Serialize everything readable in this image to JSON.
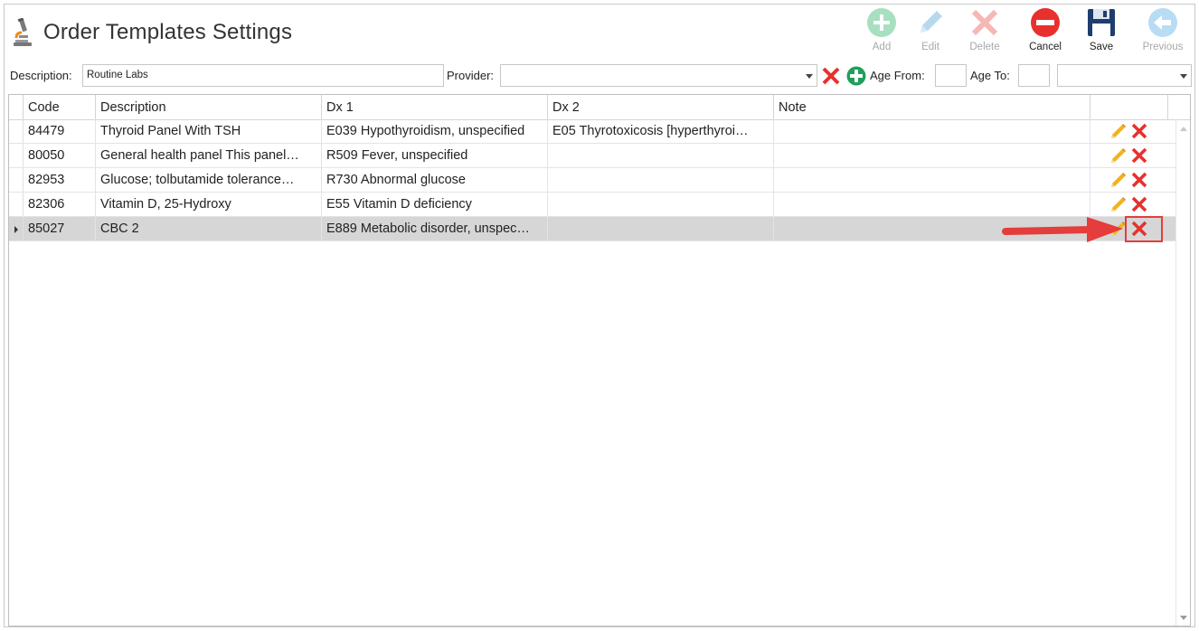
{
  "header": {
    "title": "Order Templates Settings",
    "icon": "microscope-icon"
  },
  "toolbar": {
    "buttons": [
      {
        "label": "Add",
        "icon": "add-icon",
        "enabled": false
      },
      {
        "label": "Edit",
        "icon": "edit-icon",
        "enabled": false
      },
      {
        "label": "Delete",
        "icon": "delete-icon",
        "enabled": false
      },
      {
        "label": "Cancel",
        "icon": "cancel-icon",
        "enabled": true
      },
      {
        "label": "Save",
        "icon": "save-icon",
        "enabled": true
      },
      {
        "label": "Previous",
        "icon": "previous-icon",
        "enabled": false
      }
    ]
  },
  "filters": {
    "description_label": "Description:",
    "description_value": "Routine Labs",
    "provider_label": "Provider:",
    "provider_value": "",
    "age_from_label": "Age From:",
    "age_from_value": "",
    "age_to_label": "Age To:",
    "age_to_value": "",
    "age_unit_value": ""
  },
  "grid": {
    "columns": [
      "Code",
      "Description",
      "Dx 1",
      "Dx 2",
      "Note"
    ],
    "rows": [
      {
        "code": "84479",
        "description": "Thyroid Panel With TSH",
        "dx1": "E039 Hypothyroidism, unspecified",
        "dx2": "E05 Thyrotoxicosis [hyperthyroi…",
        "note": ""
      },
      {
        "code": "80050",
        "description": "General health panel This panel…",
        "dx1": "R509 Fever, unspecified",
        "dx2": "",
        "note": ""
      },
      {
        "code": "82953",
        "description": "Glucose; tolbutamide tolerance…",
        "dx1": "R730 Abnormal glucose",
        "dx2": "",
        "note": ""
      },
      {
        "code": "82306",
        "description": "Vitamin D, 25-Hydroxy",
        "dx1": "E55 Vitamin D deficiency",
        "dx2": "",
        "note": ""
      },
      {
        "code": "85027",
        "description": "CBC 2",
        "dx1": "E889 Metabolic disorder, unspec…",
        "dx2": "",
        "note": ""
      }
    ],
    "selected_row": 4
  },
  "colors": {
    "delete_red": "#e8302c",
    "edit_yellow": "#f2b21c",
    "add_green": "#1fa05a",
    "selected_row": "#d6d6d6",
    "annotation_red": "#e53c3c"
  }
}
